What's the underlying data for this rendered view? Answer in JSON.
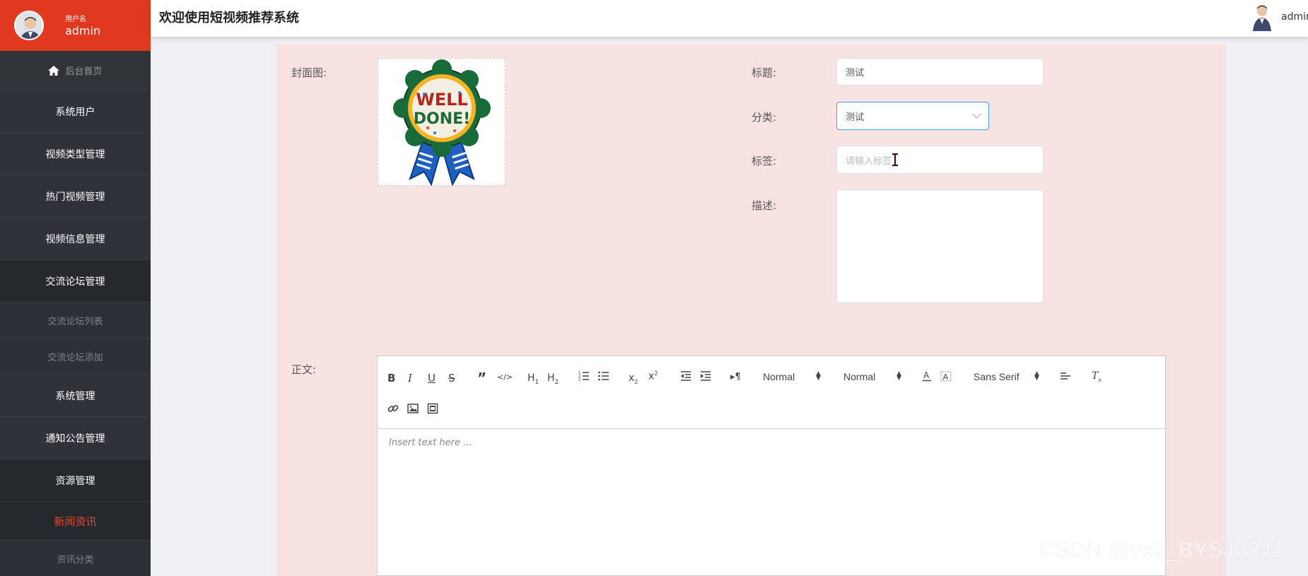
{
  "sidebar": {
    "user_label": "用户名",
    "user_name": "admin",
    "home_label": "后台首页",
    "items": [
      {
        "label": "系统用户"
      },
      {
        "label": "视频类型管理"
      },
      {
        "label": "热门视频管理"
      },
      {
        "label": "视频信息管理"
      },
      {
        "label": "交流论坛管理"
      }
    ],
    "forum_sub": [
      {
        "label": "交流论坛列表"
      },
      {
        "label": "交流论坛添加"
      }
    ],
    "items2": [
      {
        "label": "系统管理"
      },
      {
        "label": "通知公告管理"
      },
      {
        "label": "资源管理"
      }
    ],
    "resource_sub": [
      {
        "label": "新闻资讯"
      },
      {
        "label": "资讯分类"
      }
    ]
  },
  "header": {
    "title": "欢迎使用短视频推荐系统",
    "user": "admin"
  },
  "form": {
    "cover_label": "封面图:",
    "cover_badge_line1": "WELL",
    "cover_badge_line2": "DONE!",
    "title_label": "标题:",
    "title_value": "测试",
    "category_label": "分类:",
    "category_value": "测试",
    "tags_label": "标签:",
    "tags_placeholder": "请输入标签",
    "desc_label": "描述:",
    "body_label": "正文:"
  },
  "editor": {
    "font_size_1": "Normal",
    "font_size_2": "Normal",
    "font_family": "Sans Serif",
    "placeholder": "Insert text here ..."
  },
  "watermark": "CSDN @vx2_BYSJ8341",
  "colors": {
    "sidebar_bg": "#2f3238",
    "user_block": "#e0391f",
    "panel_bg": "#f7e4e2",
    "active_sub": "#e8462a"
  }
}
